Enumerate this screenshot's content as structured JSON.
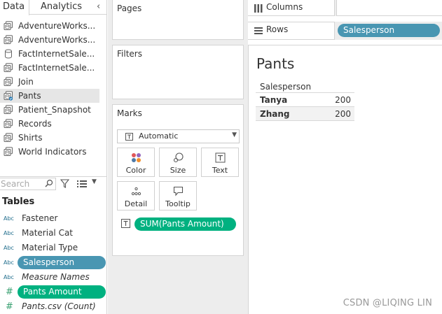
{
  "left_pane": {
    "tabs": {
      "data": "Data",
      "analytics": "Analytics"
    },
    "data_sources": [
      {
        "name": "AdventureWorks...",
        "icon": "datasource-stack-icon",
        "selected": false
      },
      {
        "name": "AdventureWorks...",
        "icon": "datasource-stack-icon",
        "selected": false
      },
      {
        "name": "FactInternetSale...",
        "icon": "database-cylinder-icon",
        "selected": false
      },
      {
        "name": "FactInternetSale...",
        "icon": "datasource-stack-icon",
        "selected": false
      },
      {
        "name": "Join",
        "icon": "datasource-stack-icon",
        "selected": false
      },
      {
        "name": "Pants",
        "icon": "datasource-active-icon",
        "selected": true
      },
      {
        "name": "Patient_Snapshot",
        "icon": "datasource-stack-icon",
        "selected": false
      },
      {
        "name": "Records",
        "icon": "datasource-stack-icon",
        "selected": false
      },
      {
        "name": "Shirts",
        "icon": "datasource-stack-icon",
        "selected": false
      },
      {
        "name": "World Indicators",
        "icon": "datasource-stack-icon",
        "selected": false
      }
    ],
    "search": {
      "placeholder": "Search"
    },
    "tables_title": "Tables",
    "fields": [
      {
        "type_label": "Abc",
        "name": "Fastener",
        "kind": "dimension",
        "pill": false,
        "italic": false
      },
      {
        "type_label": "Abc",
        "name": "Material Cat",
        "kind": "dimension",
        "pill": false,
        "italic": false
      },
      {
        "type_label": "Abc",
        "name": "Material Type",
        "kind": "dimension",
        "pill": false,
        "italic": false
      },
      {
        "type_label": "Abc",
        "name": "Salesperson",
        "kind": "dimension",
        "pill": true,
        "italic": false
      },
      {
        "type_label": "Abc",
        "name": "Measure Names",
        "kind": "dimension",
        "pill": false,
        "italic": true
      },
      {
        "type_label": "#",
        "name": "Pants Amount",
        "kind": "measure",
        "pill": true,
        "italic": false
      },
      {
        "type_label": "#",
        "name": "Pants.csv (Count)",
        "kind": "measure",
        "pill": false,
        "italic": true
      }
    ]
  },
  "cards": {
    "pages": "Pages",
    "filters": "Filters",
    "marks": {
      "title": "Marks",
      "mark_type": "Automatic",
      "buttons": {
        "color": "Color",
        "size": "Size",
        "text": "Text",
        "detail": "Detail",
        "tooltip": "Tooltip"
      },
      "field_pill": "SUM(Pants Amount)"
    }
  },
  "shelves": {
    "columns": "Columns",
    "rows": "Rows",
    "rows_pill": "Salesperson"
  },
  "view": {
    "title": "Pants",
    "table": {
      "header": "Salesperson",
      "rows": [
        {
          "name": "Tanya",
          "value": "200"
        },
        {
          "name": "Zhang",
          "value": "200"
        }
      ]
    }
  },
  "watermark": "CSDN @LIQING LIN",
  "colors": {
    "dimension_pill": "#4996b2",
    "measure_pill": "#00b180",
    "shelf_bg": "#ededed"
  }
}
